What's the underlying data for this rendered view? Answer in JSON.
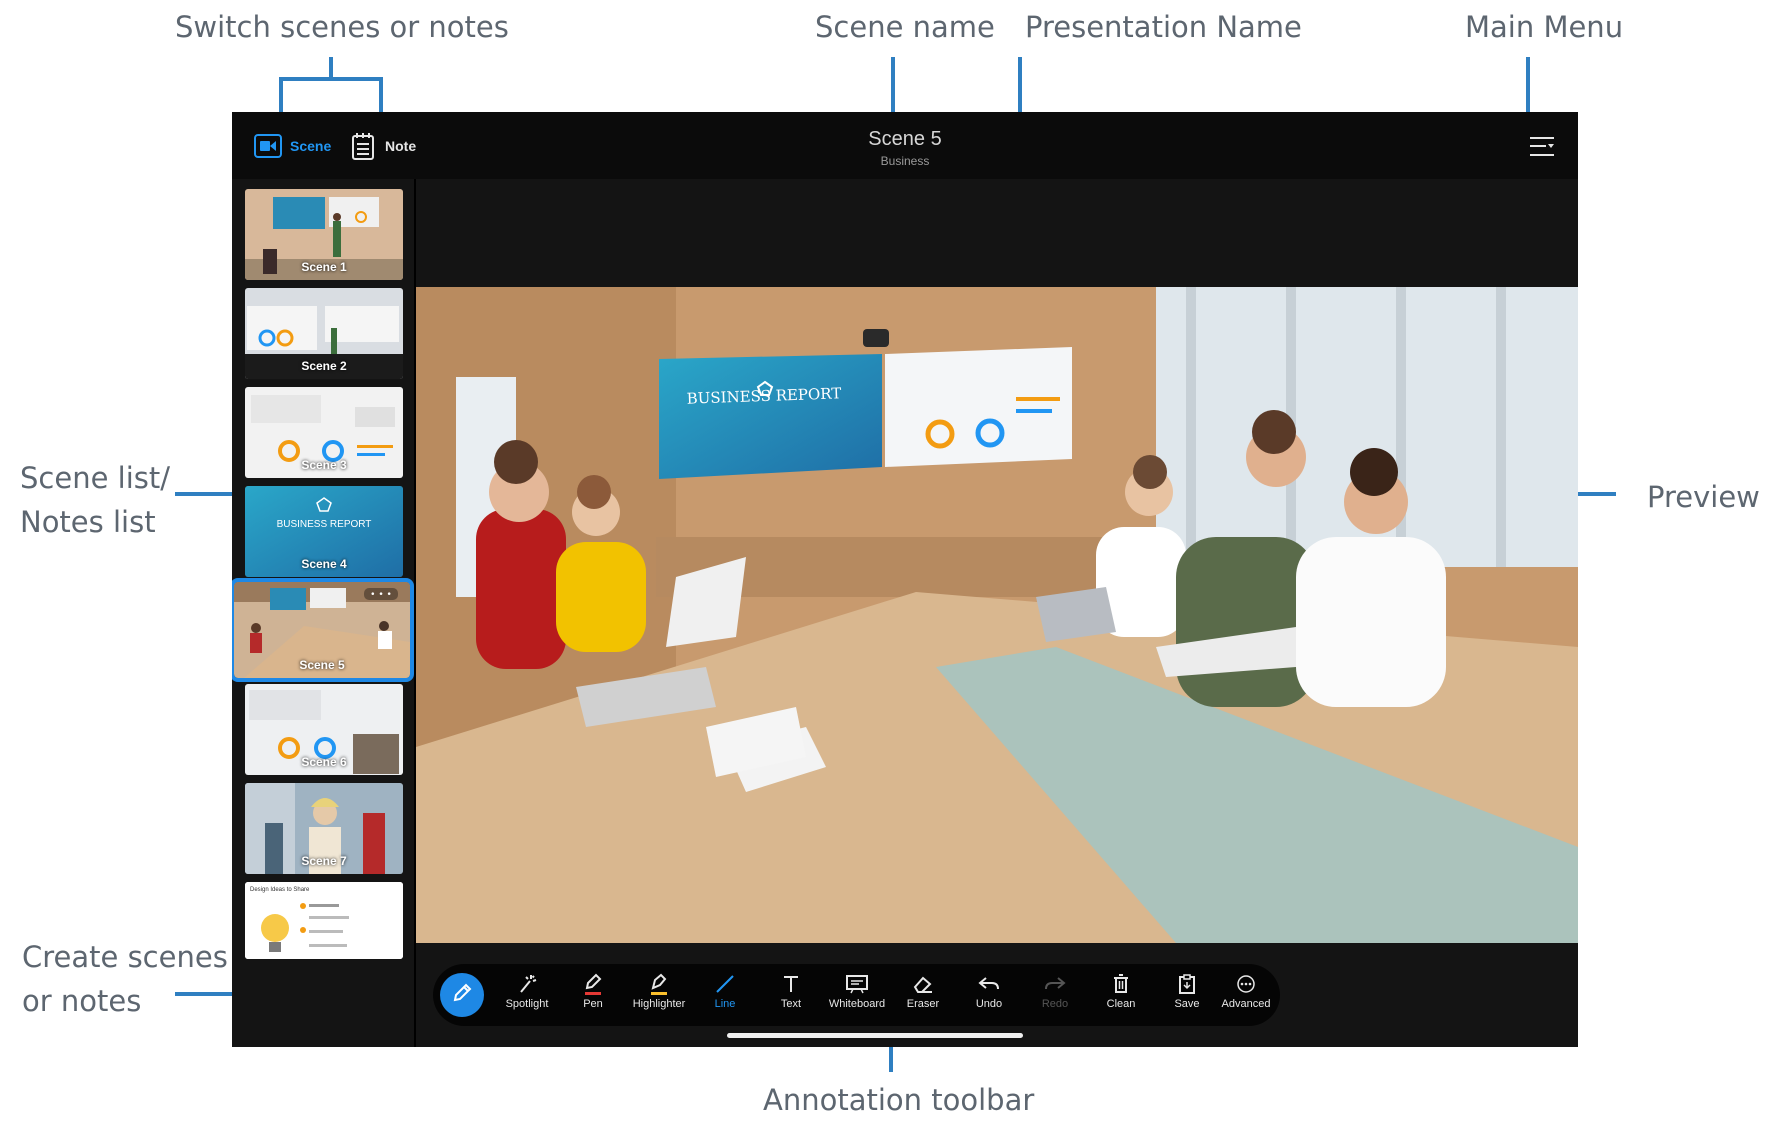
{
  "callouts": {
    "switch_scenes_notes": "Switch scenes or notes",
    "scene_name": "Scene name",
    "presentation_name": "Presentation Name",
    "main_menu": "Main Menu",
    "scene_list": "Scene list/\nNotes list",
    "preview": "Preview",
    "create_scenes": "Create scenes\nor notes",
    "annotation_toolbar": "Annotation toolbar"
  },
  "topbar": {
    "modes": [
      {
        "label": "Scene",
        "icon": "video-camera-icon",
        "active": true
      },
      {
        "label": "Note",
        "icon": "notepad-icon",
        "active": false
      }
    ],
    "scene_title": "Scene 5",
    "presentation_name": "Business",
    "menu_icon": "main-menu-icon"
  },
  "scenes": [
    {
      "label": "Scene 1",
      "active": false
    },
    {
      "label": "Scene 2",
      "active": false
    },
    {
      "label": "Scene 3",
      "active": false
    },
    {
      "label": "Scene 4",
      "active": false,
      "slide_title": "BUSINESS REPORT"
    },
    {
      "label": "Scene 5",
      "active": true
    },
    {
      "label": "Scene 6",
      "active": false
    },
    {
      "label": "Scene 7",
      "active": false
    },
    {
      "label": "",
      "active": false,
      "slide_title": "Design Ideas to Share"
    }
  ],
  "preview": {
    "screen_title": "BUSINESS REPORT"
  },
  "toolbar": {
    "tools": [
      {
        "label": "Spotlight",
        "icon": "spotlight-icon"
      },
      {
        "label": "Pen",
        "icon": "pen-icon",
        "has_submenu": true
      },
      {
        "label": "Highlighter",
        "icon": "highlighter-icon",
        "has_submenu": true
      },
      {
        "label": "Line",
        "icon": "line-icon",
        "has_submenu": true,
        "selected": true
      },
      {
        "label": "Text",
        "icon": "text-icon"
      },
      {
        "label": "Whiteboard",
        "icon": "whiteboard-icon"
      },
      {
        "label": "Eraser",
        "icon": "eraser-icon",
        "has_submenu": true
      },
      {
        "label": "Undo",
        "icon": "undo-icon"
      },
      {
        "label": "Redo",
        "icon": "redo-icon",
        "disabled": true
      },
      {
        "label": "Clean",
        "icon": "trash-icon"
      },
      {
        "label": "Save",
        "icon": "save-icon"
      },
      {
        "label": "Advanced",
        "icon": "more-icon"
      }
    ]
  },
  "colors": {
    "accent": "#1e88e5",
    "callout_line": "#2f7fc1",
    "app_bg": "#141414",
    "pen_color": "#e53935",
    "highlighter_color": "#fbc02d"
  }
}
